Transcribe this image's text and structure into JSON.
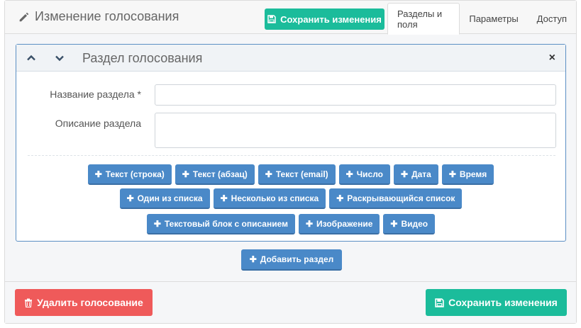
{
  "header": {
    "title": "Изменение голосования",
    "icon": "pencil-icon",
    "save_label": "Сохранить изменения",
    "tabs": [
      {
        "label": "Разделы и поля",
        "active": true
      },
      {
        "label": "Параметры",
        "active": false
      },
      {
        "label": "Доступ",
        "active": false
      }
    ]
  },
  "section": {
    "title": "Раздел голосования",
    "close_glyph": "×",
    "name_label": "Название раздела *",
    "name_value": "",
    "desc_label": "Описание раздела",
    "desc_value": "",
    "field_buttons": {
      "row1": [
        "Текст (строка)",
        "Текст (абзац)",
        "Текст (email)",
        "Число",
        "Дата",
        "Время"
      ],
      "row2": [
        "Один из списка",
        "Несколько из списка",
        "Раскрывающийся список"
      ],
      "row3": [
        "Текстовый блок с описанием",
        "Изображение",
        "Видео"
      ]
    }
  },
  "add_section_label": "Добавить раздел",
  "footer": {
    "delete_label": "Удалить голосование",
    "save_label": "Сохранить изменения"
  },
  "colors": {
    "teal": "#1bbc9b",
    "blue": "#4a89c8",
    "red": "#ef5a5a"
  }
}
